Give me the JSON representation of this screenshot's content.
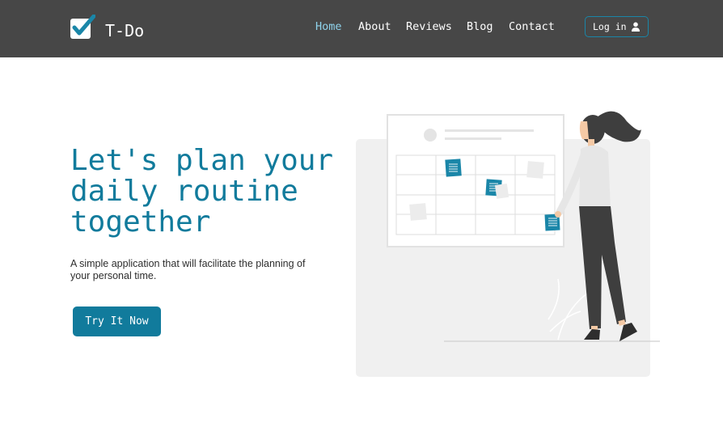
{
  "brand": {
    "name": "T-Do",
    "logo_icon": "check-square-icon"
  },
  "nav": {
    "items": [
      {
        "label": "Home",
        "active": true
      },
      {
        "label": "About",
        "active": false
      },
      {
        "label": "Reviews",
        "active": false
      },
      {
        "label": "Blog",
        "active": false
      },
      {
        "label": "Contact",
        "active": false
      }
    ],
    "login_label": "Log in",
    "login_icon": "user-icon"
  },
  "hero": {
    "title": "Let's plan your daily routine together",
    "subtitle": "A simple application that will facilitate the planning of your personal time.",
    "cta_label": "Try It Now"
  },
  "illustration": {
    "icon": "woman-planning-calendar-illustration"
  },
  "colors": {
    "navbar_bg": "#474747",
    "accent": "#117b9c",
    "active_nav": "#8fd3ec",
    "illustration_bg": "#f0f0f0"
  }
}
